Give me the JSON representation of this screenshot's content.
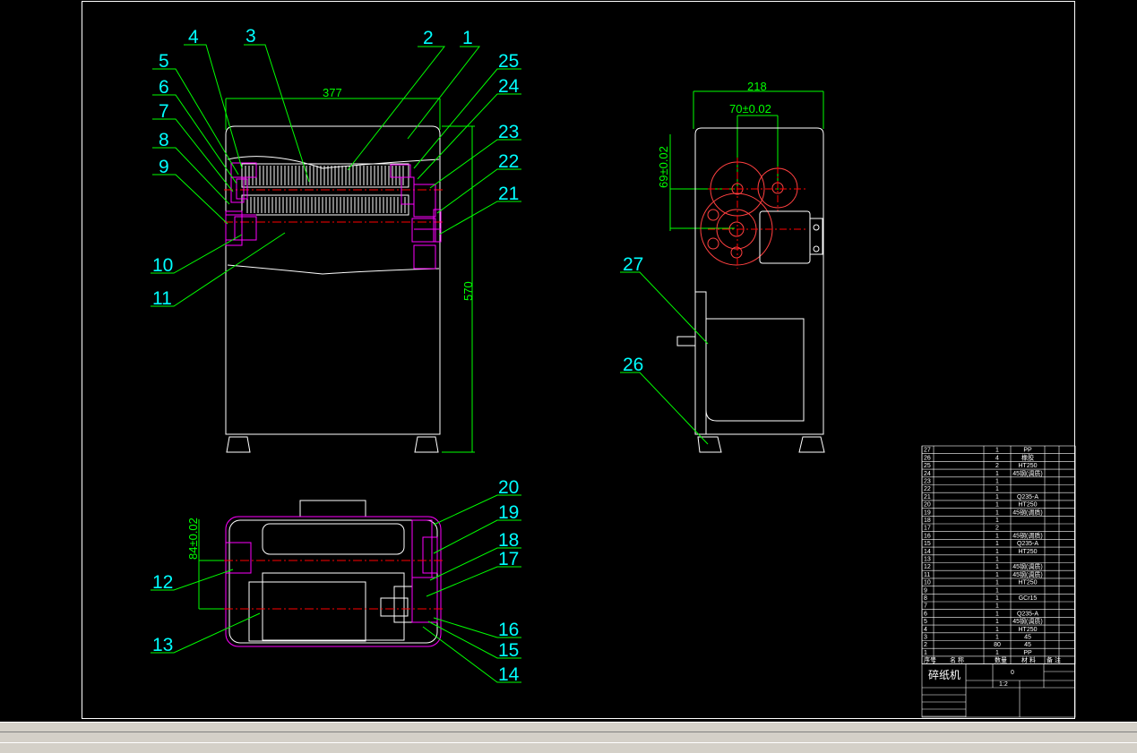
{
  "callouts": [
    "1",
    "2",
    "3",
    "4",
    "5",
    "6",
    "7",
    "8",
    "9",
    "10",
    "11",
    "12",
    "13",
    "14",
    "15",
    "16",
    "17",
    "18",
    "19",
    "20",
    "21",
    "22",
    "23",
    "24",
    "25",
    "26",
    "27"
  ],
  "dimensions": {
    "front_width": "377",
    "front_height": "570",
    "side_width": "218",
    "side_center": "70±0.02",
    "side_vertical": "69±0.02",
    "top_offset": "84±0.02"
  },
  "title_block": {
    "name": "碎纸机",
    "scale": "1:2",
    "sheet": "0",
    "headers": [
      "序号",
      "名 称",
      "数量",
      "材 料",
      "备 注"
    ],
    "parts": [
      {
        "no": "27",
        "qty": "1",
        "mat": "PP"
      },
      {
        "no": "26",
        "qty": "4",
        "mat": "橡胶"
      },
      {
        "no": "25",
        "qty": "2",
        "mat": "HT250"
      },
      {
        "no": "24",
        "qty": "1",
        "mat": "45钢(调质)"
      },
      {
        "no": "23",
        "qty": "1",
        "mat": ""
      },
      {
        "no": "22",
        "qty": "1",
        "mat": ""
      },
      {
        "no": "21",
        "qty": "1",
        "mat": "Q235-A"
      },
      {
        "no": "20",
        "qty": "1",
        "mat": "HT250"
      },
      {
        "no": "19",
        "qty": "1",
        "mat": "45钢(调质)"
      },
      {
        "no": "18",
        "qty": "1",
        "mat": ""
      },
      {
        "no": "17",
        "qty": "2",
        "mat": ""
      },
      {
        "no": "16",
        "qty": "1",
        "mat": "45钢(调质)"
      },
      {
        "no": "15",
        "qty": "1",
        "mat": "Q235-A"
      },
      {
        "no": "14",
        "qty": "1",
        "mat": "HT250"
      },
      {
        "no": "13",
        "qty": "1",
        "mat": ""
      },
      {
        "no": "12",
        "qty": "1",
        "mat": "45钢(调质)"
      },
      {
        "no": "11",
        "qty": "1",
        "mat": "45钢(调质)"
      },
      {
        "no": "10",
        "qty": "1",
        "mat": "HT250"
      },
      {
        "no": "9",
        "qty": "1",
        "mat": ""
      },
      {
        "no": "8",
        "qty": "1",
        "mat": "GCr15"
      },
      {
        "no": "7",
        "qty": "1",
        "mat": ""
      },
      {
        "no": "6",
        "qty": "1",
        "mat": "Q235-A"
      },
      {
        "no": "5",
        "qty": "1",
        "mat": "45钢(调质)"
      },
      {
        "no": "4",
        "qty": "1",
        "mat": "HT250"
      },
      {
        "no": "3",
        "qty": "1",
        "mat": "45"
      },
      {
        "no": "2",
        "qty": "80",
        "mat": "45"
      },
      {
        "no": "1",
        "qty": "1",
        "mat": "PP"
      }
    ]
  },
  "colors": {
    "frame": "#ffffff",
    "callout": "#00ffff",
    "leader": "#00ff00",
    "dimension": "#00ff00",
    "part": "#ff00ff",
    "centerline": "#ff0000",
    "outline": "#ffffff"
  }
}
